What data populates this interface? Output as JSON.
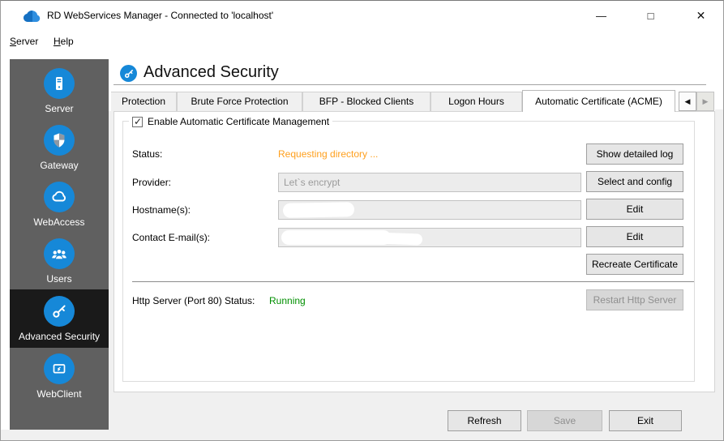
{
  "titlebar": {
    "title": "RD WebServices Manager - Connected to 'localhost'",
    "minimize_glyph": "—",
    "maximize_glyph": "□",
    "close_glyph": "✕"
  },
  "menubar": {
    "server": {
      "accel": "S",
      "rest": "erver"
    },
    "help": {
      "accel": "H",
      "rest": "elp"
    }
  },
  "sidebar": {
    "items": [
      {
        "label": "Server",
        "icon": "server-icon",
        "selected": false
      },
      {
        "label": "Gateway",
        "icon": "shield-icon",
        "selected": false
      },
      {
        "label": "WebAccess",
        "icon": "cloud-icon",
        "selected": false
      },
      {
        "label": "Users",
        "icon": "users-icon",
        "selected": false
      },
      {
        "label": "Advanced Security",
        "icon": "key-icon",
        "selected": true
      },
      {
        "label": "WebClient",
        "icon": "monitor-icon",
        "selected": false
      }
    ]
  },
  "header": {
    "title": "Advanced Security"
  },
  "tabs": {
    "items": [
      {
        "label": "Protection"
      },
      {
        "label": "Brute Force Protection"
      },
      {
        "label": "BFP - Blocked Clients"
      },
      {
        "label": "Logon Hours"
      },
      {
        "label": "Automatic Certificate (ACME)"
      }
    ],
    "active": "Automatic Certificate (ACME)",
    "scroll_left_glyph": "◀",
    "scroll_right_glyph": "▶"
  },
  "acme": {
    "enable_label": "Enable Automatic Certificate Management",
    "enable_checked": true,
    "check_glyph": "✓",
    "status_label": "Status:",
    "status_value": "Requesting directory ...",
    "show_log_button": "Show detailed log",
    "provider_label": "Provider:",
    "provider_value": "Let`s encrypt",
    "provider_button": "Select and config",
    "hostnames_label": "Hostname(s):",
    "hostnames_redacted": true,
    "hostnames_button": "Edit",
    "emails_label": "Contact E-mail(s):",
    "emails_redacted": true,
    "emails_button": "Edit",
    "recreate_button": "Recreate Certificate",
    "http_label": "Http Server (Port 80) Status:",
    "http_value": "Running",
    "restart_button": "Restart Http Server",
    "restart_enabled": false
  },
  "footer": {
    "refresh": "Refresh",
    "save": "Save",
    "save_enabled": false,
    "exit": "Exit"
  },
  "colors": {
    "accent_blue": "#1688d8",
    "status_orange": "#ffa01e",
    "status_green": "#008f00",
    "sidebar_gray": "#606060",
    "selected_dark": "#1a1a1a"
  }
}
